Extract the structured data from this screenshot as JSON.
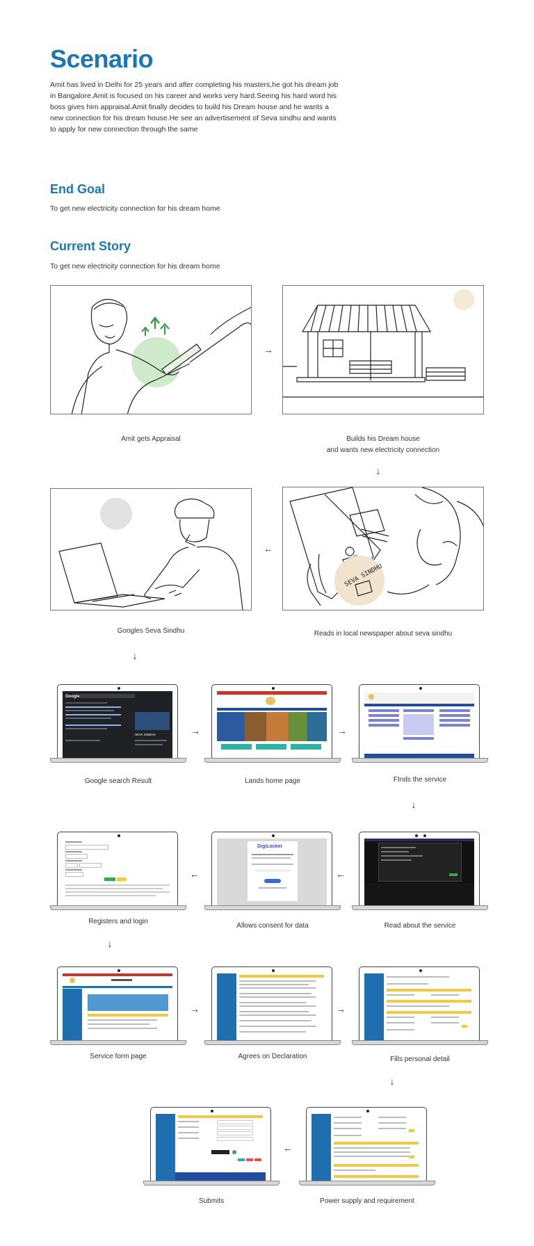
{
  "scenario": {
    "title": "Scenario",
    "paragraph": "Amit has lived in Delhi for 25 years and after completing his masters,he got his dream job in Bangalore.Amit is focused on his career and works very hard.Seeing his hard word his boss gives him appraisal.Amit finally decides to build his Dream house and he wants a new connection for his dream house.He see an advertisement of Seva sindhu and wants to apply for new connection through the same"
  },
  "end_goal": {
    "title": "End Goal",
    "text": "To get new electricity connection for his dream home"
  },
  "current_story": {
    "title": "Current Story",
    "text": "To get new electricity connection for his dream home"
  },
  "illustrations": {
    "amit_appraisal": "Amit gets Appraisal",
    "dream_house_line1": "Builds his Dream house",
    "dream_house_line2": "and wants new electricity connection",
    "googles": "Googles Seva Sindhu",
    "newspaper": "Reads in local newspaper about seva sindhu",
    "newspaper_stamp": "SEVA SINDHU"
  },
  "screens": {
    "google_search": "Google search Result",
    "lands_home": "Lands home page",
    "finds_service": "FInds the service",
    "read_service": "Read about the service",
    "allows_consent": "Allows consent for data",
    "registers_login": "Registers and login",
    "service_form": "Service form page",
    "agrees_declaration": "Agrees on Declaration",
    "fills_personal": "Fills personal detail",
    "power_supply": "Power supply and requirement",
    "submits": "Submits",
    "digilocker_logo": "DigiLocker",
    "google_logo": "Google",
    "seva_sindhu_label": "SEVA SINDHU"
  },
  "arrows": {
    "right": "→",
    "left": "←",
    "down": "↓"
  },
  "colors": {
    "heading": "#1a78b8",
    "form_blue": "#1f6fb0",
    "form_yellow": "#f4c842",
    "appraisal_green": "#2e9b3c",
    "sun": "#f3ecd2",
    "newspaper_circle": "#f2e3cf"
  }
}
